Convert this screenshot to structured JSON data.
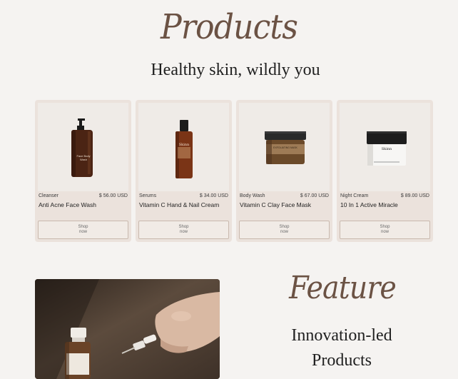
{
  "products": {
    "title": "Products",
    "subtitle": "Healthy skin, wildly you",
    "items": [
      {
        "category": "Cleanser",
        "price": "$ 56.00 USD",
        "name": "Anti Acne Face Wash",
        "shop_label": "Shop now",
        "bottle_label": "Face Body Wash"
      },
      {
        "category": "Serums",
        "price": "$ 34.00 USD",
        "name": "Vitamin C Hand & Nail Cream",
        "shop_label": "Shop now",
        "bottle_label": "Skinn"
      },
      {
        "category": "Body Wash",
        "price": "$ 67.00 USD",
        "name": "Vitamin C Clay Face Mask",
        "shop_label": "Shop now",
        "bottle_label": "EXFOLIATING MASK"
      },
      {
        "category": "Night Cream",
        "price": "$ 89.00 USD",
        "name": "10 In 1 Active Miracle",
        "shop_label": "Shop now",
        "bottle_label": "Skinn"
      }
    ]
  },
  "feature": {
    "title": "Feature",
    "subtitle": "Innovation-led Products"
  }
}
